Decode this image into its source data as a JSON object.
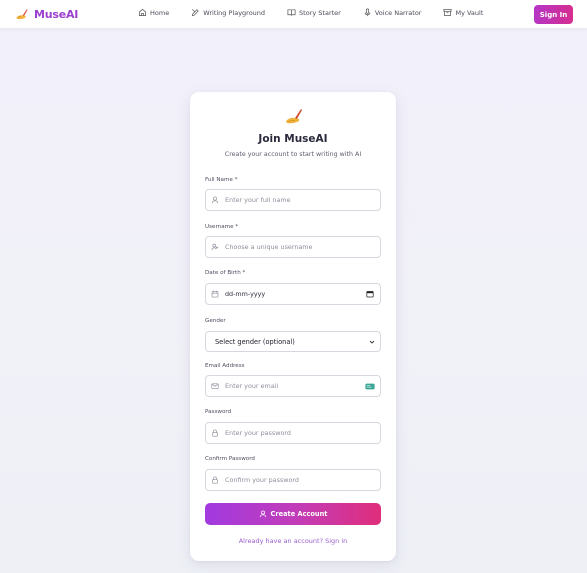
{
  "brand": {
    "name": "MuseAI",
    "icon": "quill-hand-icon"
  },
  "nav": {
    "items": [
      {
        "label": "Home",
        "icon": "home-icon"
      },
      {
        "label": "Writing Playground",
        "icon": "pen-icon"
      },
      {
        "label": "Story Starter",
        "icon": "book-icon"
      },
      {
        "label": "Voice Narrator",
        "icon": "mic-icon"
      },
      {
        "label": "My Vault",
        "icon": "archive-icon"
      }
    ],
    "signin_label": "Sign In"
  },
  "form": {
    "title": "Join MuseAI",
    "subtitle": "Create your account to start writing with AI",
    "full_name": {
      "label": "Full Name *",
      "placeholder": "Enter your full name"
    },
    "username": {
      "label": "Username *",
      "placeholder": "Choose a unique username"
    },
    "dob": {
      "label": "Date of Birth *",
      "value": "dd-mm-yyyy"
    },
    "gender": {
      "label": "Gender",
      "value": "Select gender (optional)"
    },
    "email": {
      "label": "Email Address",
      "placeholder": "Enter your email"
    },
    "password": {
      "label": "Password",
      "placeholder": "Enter your password"
    },
    "confirm_password": {
      "label": "Confirm Password",
      "placeholder": "Confirm your password"
    },
    "submit_label": "Create Account",
    "signin_link": "Already have an account? Sign in"
  },
  "colors": {
    "brand": "#9a3fd0",
    "button_start": "#a13ae0",
    "button_end": "#df2d7b",
    "link": "#9a5fd0"
  }
}
